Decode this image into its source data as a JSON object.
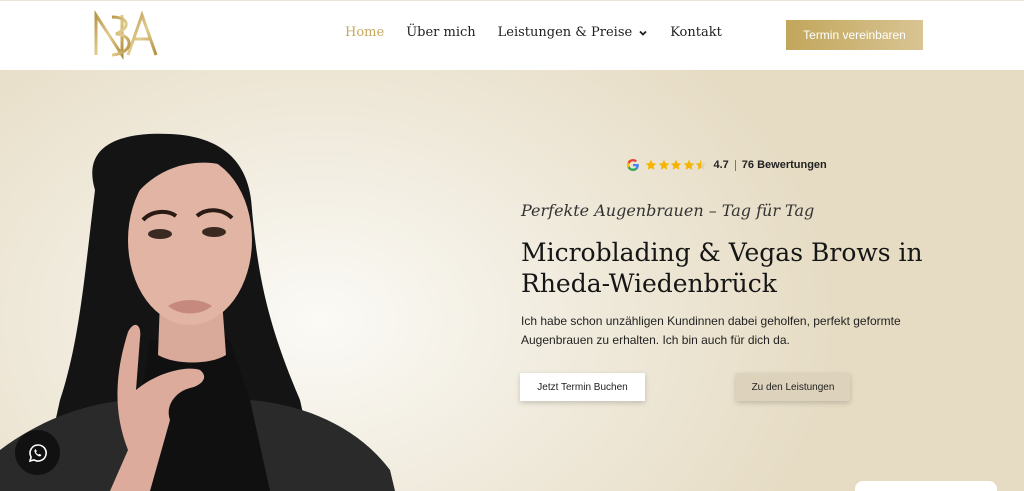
{
  "header": {
    "logo_text": "NBA",
    "nav": [
      {
        "label": "Home",
        "active": true
      },
      {
        "label": "Über mich",
        "active": false
      },
      {
        "label": "Leistungen & Preise",
        "active": false,
        "dropdown": true
      },
      {
        "label": "Kontakt",
        "active": false
      }
    ],
    "cta_label": "Termin vereinbaren"
  },
  "hero": {
    "rating": {
      "score": "4.7",
      "reviews": "76 Bewertungen",
      "stars": 4.5,
      "icon": "google-icon"
    },
    "tagline": "Perfekte Augenbrauen – Tag für Tag",
    "headline": "Microblading & Vegas Brows in Rheda-Wiedenbrück",
    "intro": "Ich habe schon unzähligen Kundinnen dabei geholfen, perfekt geformte Augenbrauen zu erhalten. Ich bin auch für dich da.",
    "btn_book": "Jetzt Termin Buchen",
    "btn_services": "Zu den Leistungen"
  },
  "floating": {
    "whatsapp_icon": "whatsapp-icon"
  },
  "colors": {
    "gold": "#c6a95b",
    "hero_bg": "#e6dcc4",
    "dark": "#111111"
  }
}
